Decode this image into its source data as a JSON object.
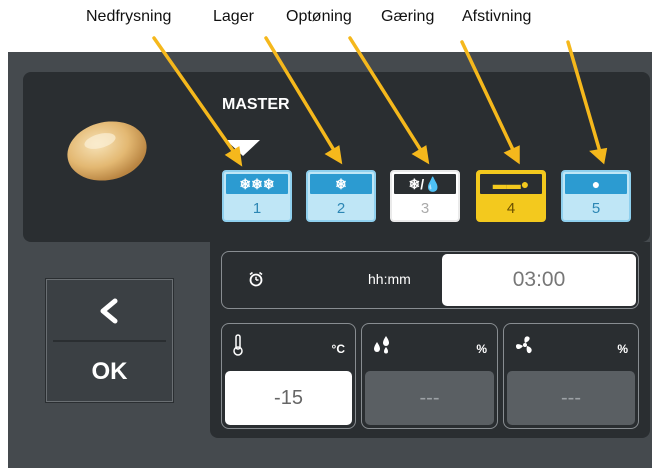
{
  "annotations": {
    "labels": [
      "Nedfrysning",
      "Lager",
      "Optøning",
      "Gæring",
      "Afstivning"
    ],
    "arrow_color": "#f5b81c"
  },
  "screen": {
    "master_label": "MASTER",
    "modes": [
      {
        "icon": "❄❄❄",
        "number": "1",
        "style": "blue",
        "icon_name": "triple-snowflake-icon"
      },
      {
        "icon": "❄",
        "number": "2",
        "style": "blue",
        "icon_name": "snowflake-icon"
      },
      {
        "icon": "❄/💧",
        "number": "3",
        "style": "white",
        "icon_name": "thaw-icon"
      },
      {
        "icon": "▬▬●",
        "number": "4",
        "style": "yellow",
        "icon_name": "proofing-icon"
      },
      {
        "icon": "●",
        "number": "5",
        "style": "blue",
        "icon_name": "bread-icon"
      }
    ],
    "timer": {
      "unit_label": "hh:mm",
      "value": "03:00"
    },
    "temperature": {
      "unit": "°C",
      "value": "-15"
    },
    "humidity": {
      "unit": "%",
      "value": "---"
    },
    "fan": {
      "unit": "%",
      "value": "---"
    },
    "nav": {
      "ok_label": "OK",
      "back_symbol": "<"
    }
  }
}
